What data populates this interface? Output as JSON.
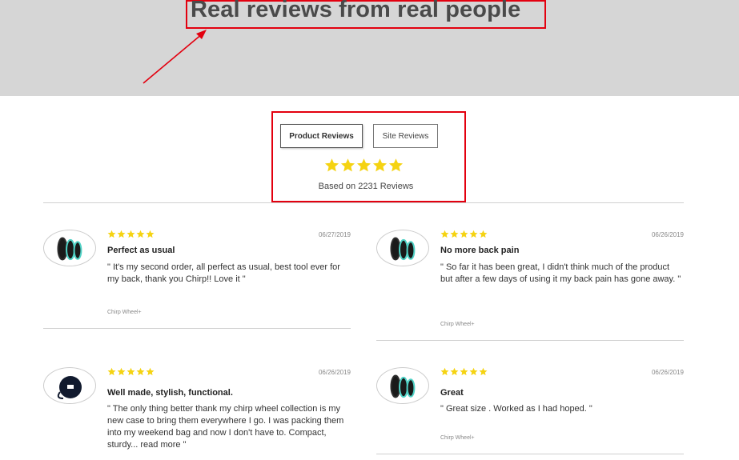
{
  "hero": {
    "title": "Real reviews from real people"
  },
  "tabs": {
    "product_label": "Product Reviews",
    "site_label": "Site Reviews"
  },
  "summary": {
    "rating_stars": 5,
    "based_on": "Based on 2231 Reviews"
  },
  "colors": {
    "star": "#f5d312",
    "highlight": "#e3000f",
    "hero_bg": "#d6d6d6"
  },
  "reviews": [
    {
      "rating": 5,
      "date": "06/27/2019",
      "title": "Perfect as usual",
      "body": "\" It's my second order, all perfect as usual, best tool ever for my back, thank you Chirp!! Love it \"",
      "product": "Chirp Wheel+",
      "image": "wheels-icon"
    },
    {
      "rating": 5,
      "date": "06/26/2019",
      "title": "No more back pain",
      "body": "\" So far it has been great, I didn't think much of the product but after a few days of using it my back pain has gone away. \"",
      "product": "Chirp Wheel+",
      "image": "wheels-icon"
    },
    {
      "rating": 5,
      "date": "06/26/2019",
      "title": "Well made, stylish, functional.",
      "body": "\" The only thing better thank my chirp wheel collection is my new case to bring them everywhere I go. I was packing them into my weekend bag and now I don't have to. Compact, sturdy...",
      "read_more": "read more \"",
      "product": "",
      "image": "case-icon"
    },
    {
      "rating": 5,
      "date": "06/26/2019",
      "title": "Great",
      "body": "\" Great size . Worked as I had hoped. \"",
      "product": "Chirp Wheel+",
      "image": "wheels-icon"
    }
  ]
}
